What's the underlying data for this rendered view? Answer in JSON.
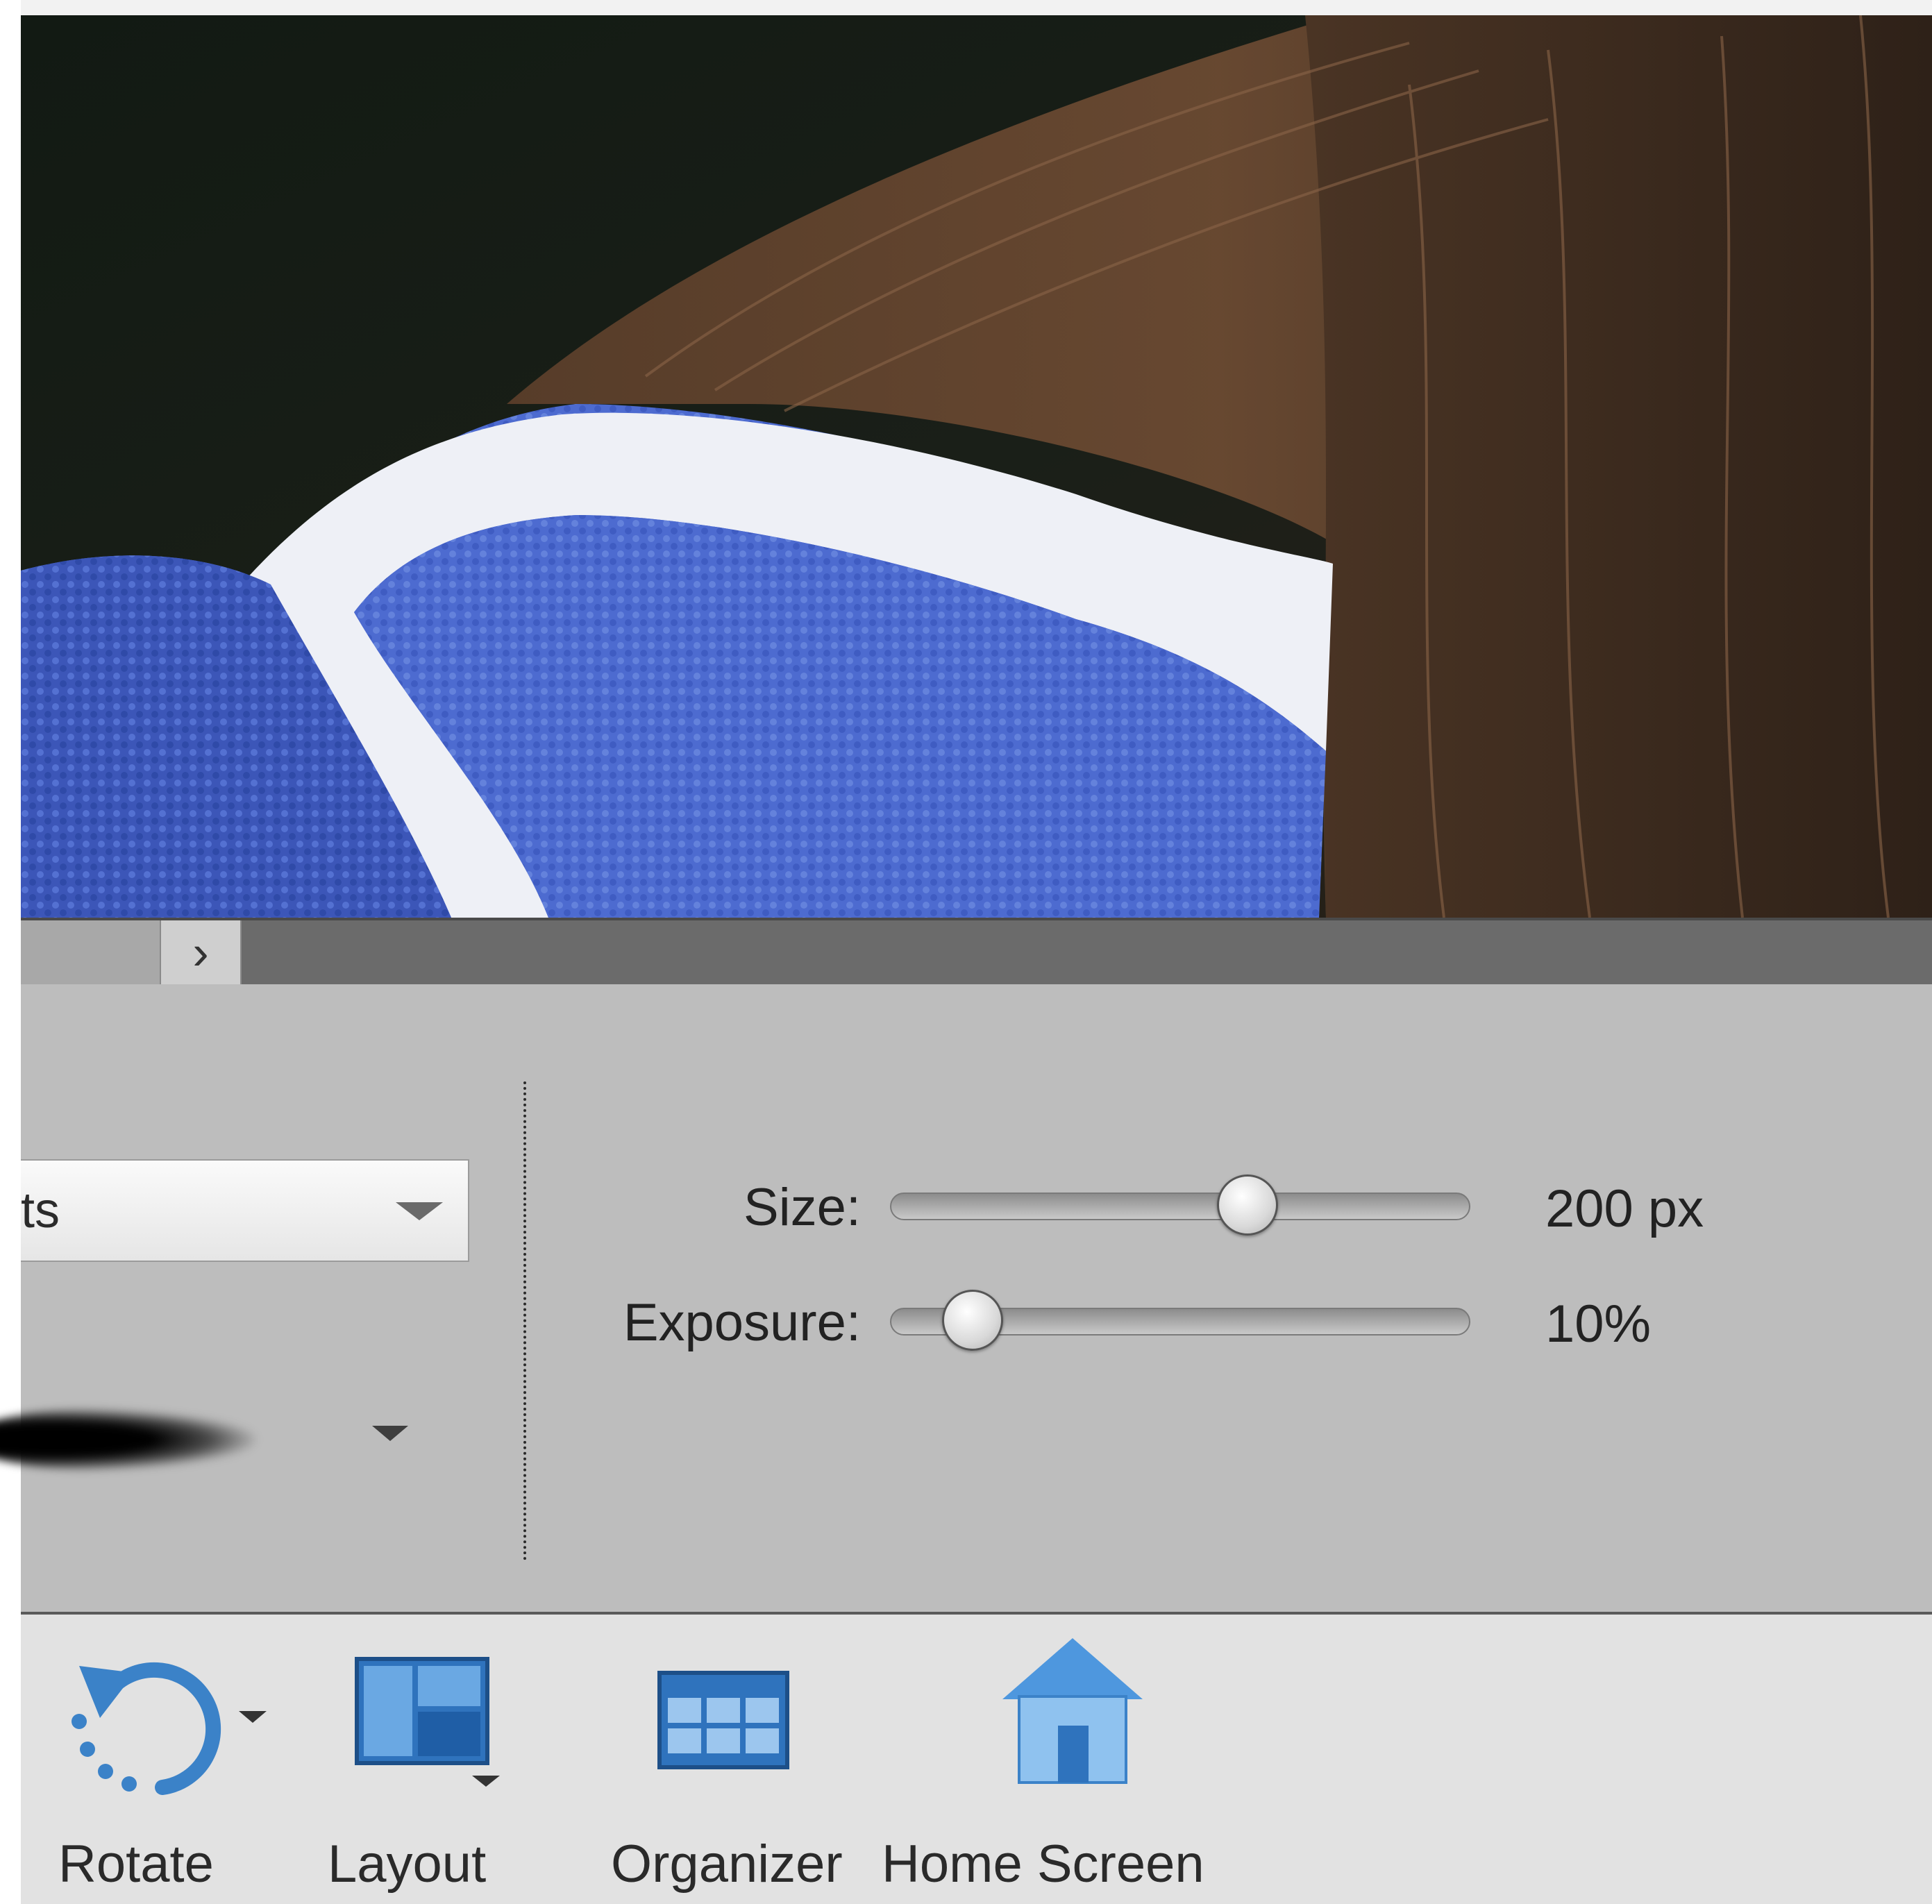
{
  "scroll_strip": {
    "next_glyph": "›"
  },
  "tool_options": {
    "preset_value": "ts",
    "size_label": "Size:",
    "size_value": "200 px",
    "size_level": 0.63,
    "exposure_label": "Exposure:",
    "exposure_value": "10%",
    "exposure_level": 0.1
  },
  "taskbar": {
    "rotate": {
      "label": "Rotate",
      "icon": "rotate-icon"
    },
    "layout": {
      "label": "Layout",
      "icon": "layout-icon"
    },
    "organizer": {
      "label": "Organizer",
      "icon": "organizer-icon"
    },
    "home": {
      "label": "Home Screen",
      "icon": "home-icon"
    }
  },
  "colors": {
    "panel": "#bdbdbd",
    "taskbar": "#e2e2e2",
    "icon_blue": "#3b82c8",
    "sweater_blue": "#4f6fcf"
  }
}
